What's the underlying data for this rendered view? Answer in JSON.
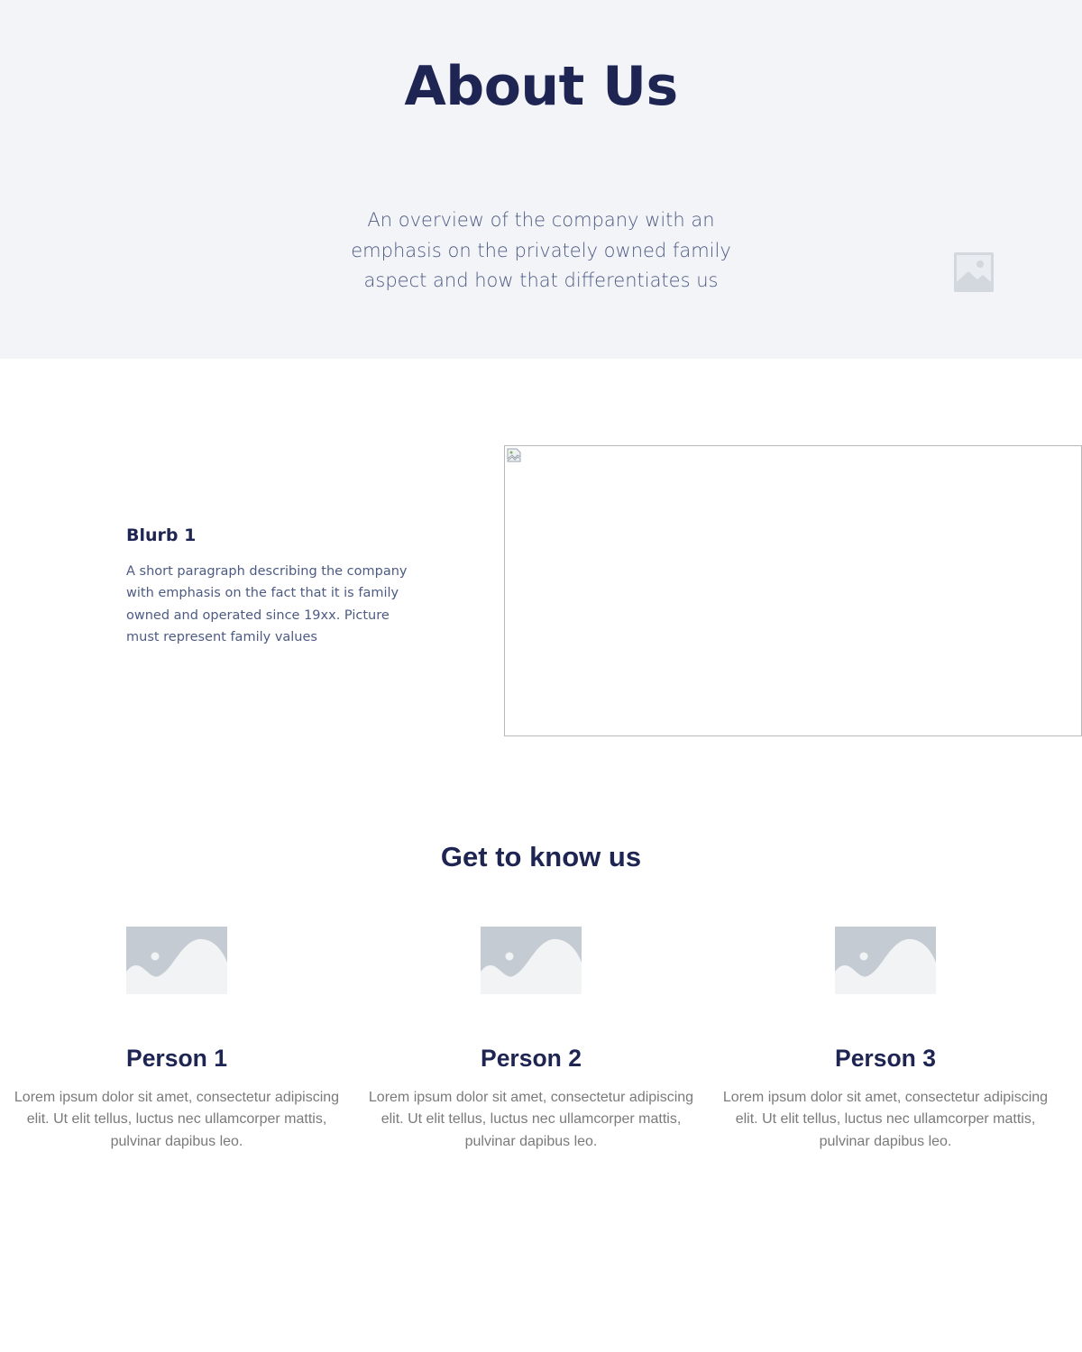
{
  "hero": {
    "title": "About Us",
    "subtitle": "An overview of the company with an emphasis on the privately owned family aspect and how that differentiates us",
    "image_icon": "image-placeholder-icon"
  },
  "blurb": {
    "title": "Blurb 1",
    "text": "A short paragraph describing the company with emphasis on the fact that it is family owned and operated since 19xx. Picture must represent family values",
    "image_icon": "broken-image-icon"
  },
  "team": {
    "title": "Get to know us",
    "members": [
      {
        "name": "Person 1",
        "bio": "Lorem ipsum dolor sit amet, consectetur adipiscing elit. Ut elit tellus, luctus nec ullamcorper mattis, pulvinar dapibus leo.",
        "photo_icon": "image-placeholder-icon"
      },
      {
        "name": "Person 2",
        "bio": "Lorem ipsum dolor sit amet, consectetur adipiscing elit. Ut elit tellus, luctus nec ullamcorper mattis, pulvinar dapibus leo.",
        "photo_icon": "image-placeholder-icon"
      },
      {
        "name": "Person 3",
        "bio": "Lorem ipsum dolor sit amet, consectetur adipiscing elit. Ut elit tellus, luctus nec ullamcorper mattis, pulvinar dapibus leo.",
        "photo_icon": "image-placeholder-icon"
      }
    ]
  },
  "colors": {
    "hero_background": "#f3f4f8",
    "heading": "#1e2553",
    "body_text": "#4d5b83",
    "muted_text": "#7a7a7a",
    "placeholder": "#c5cbd3"
  }
}
